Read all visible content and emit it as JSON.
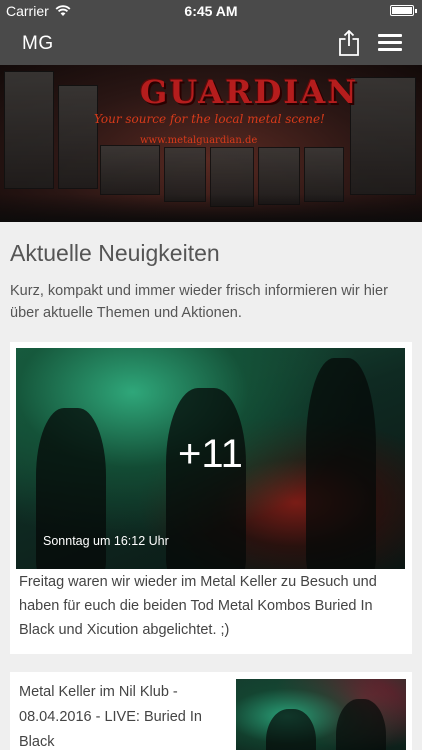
{
  "status_bar": {
    "carrier": "Carrier",
    "time": "6:45 AM"
  },
  "navbar": {
    "brand": "MG"
  },
  "banner": {
    "logo_text": "GUARDIAN",
    "tagline": "Your source for the local metal scene!",
    "url": "www.metalguardian.de"
  },
  "main": {
    "title": "Aktuelle Neuigkeiten",
    "intro": "Kurz, kompakt und immer wieder frisch informieren wir hier über aktuelle Themen und Aktionen."
  },
  "posts": [
    {
      "photo_count": "+11",
      "date": "Sonntag um 16:12 Uhr",
      "caption": "Freitag waren wir wieder im Metal Keller zu Besuch und haben für euch die beiden Tod Metal Kombos Buried In Black und Xicution abgelichtet. ;)"
    },
    {
      "title": "Metal Keller im Nil Klub - 08.04.2016 - LIVE: Buried In Black"
    }
  ],
  "colors": {
    "bar_bg": "#4a4a4a",
    "page_bg": "#efefef",
    "card_bg": "#ffffff",
    "text": "#555555",
    "logo_red": "#b51d1d"
  }
}
